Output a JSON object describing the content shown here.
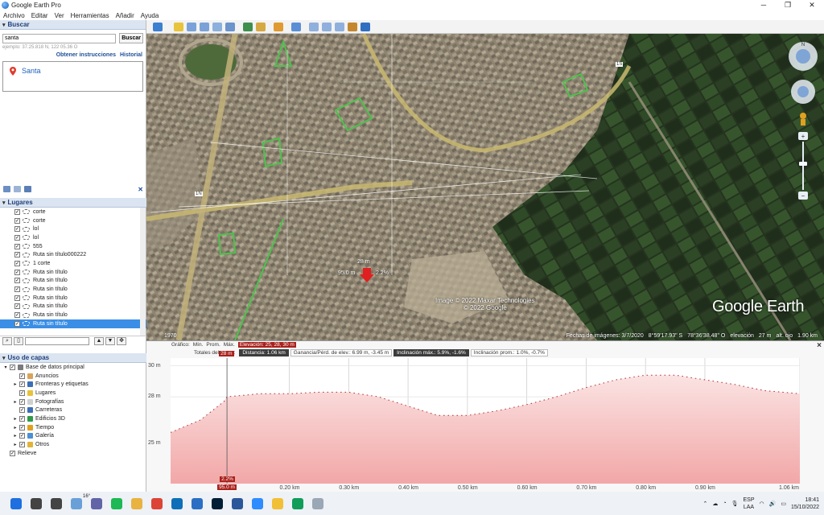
{
  "window": {
    "title": "Google Earth Pro",
    "min": "─",
    "max": "❐",
    "close": "✕"
  },
  "menu": [
    "Archivo",
    "Editar",
    "Ver",
    "Herramientas",
    "Añadir",
    "Ayuda"
  ],
  "search": {
    "header": "Buscar",
    "query": "santa",
    "button": "Buscar",
    "hint": "ejemplo: 37.25.818 N, 122 05.36 O",
    "directions_link": "Obtener instrucciones",
    "history_link": "Historial",
    "result": "Santa"
  },
  "places": {
    "header": "Lugares",
    "items": [
      {
        "label": "corte",
        "checked": true,
        "selected": false
      },
      {
        "label": "corte",
        "checked": true,
        "selected": false
      },
      {
        "label": "lol",
        "checked": true,
        "selected": false
      },
      {
        "label": "lol",
        "checked": true,
        "selected": false
      },
      {
        "label": "555",
        "checked": true,
        "selected": false
      },
      {
        "label": "Ruta sin título000222",
        "checked": true,
        "selected": false
      },
      {
        "label": "1 corte",
        "checked": true,
        "selected": false
      },
      {
        "label": "Ruta sin título",
        "checked": true,
        "selected": false
      },
      {
        "label": "Ruta sin título",
        "checked": true,
        "selected": false
      },
      {
        "label": "Ruta sin título",
        "checked": true,
        "selected": false
      },
      {
        "label": "Ruta sin título",
        "checked": true,
        "selected": false
      },
      {
        "label": "Ruta sin título",
        "checked": true,
        "selected": false
      },
      {
        "label": "Ruta sin título",
        "checked": true,
        "selected": false
      },
      {
        "label": "Ruta sin título",
        "checked": true,
        "selected": true
      }
    ]
  },
  "layers": {
    "header": "Uso de capas",
    "items": [
      {
        "label": "Base de datos principal",
        "indent": 0,
        "expander": "▾",
        "color": "#7a7a7a"
      },
      {
        "label": "Anuncios",
        "indent": 1,
        "expander": "",
        "color": "#d8a35a"
      },
      {
        "label": "Fronteras y etiquetas",
        "indent": 1,
        "expander": "▸",
        "color": "#3b6fb6"
      },
      {
        "label": "Lugares",
        "indent": 1,
        "expander": "",
        "color": "#e7c23a"
      },
      {
        "label": "Fotografías",
        "indent": 1,
        "expander": "▸",
        "color": "#cfcfcf"
      },
      {
        "label": "Carreteras",
        "indent": 1,
        "expander": "",
        "color": "#3b6fb6"
      },
      {
        "label": "Edificios 3D",
        "indent": 1,
        "expander": "▸",
        "color": "#2f9a4a"
      },
      {
        "label": "Tiempo",
        "indent": 1,
        "expander": "▸",
        "color": "#e0a020"
      },
      {
        "label": "Galería",
        "indent": 1,
        "expander": "▸",
        "color": "#4b8fd4"
      },
      {
        "label": "Otros",
        "indent": 1,
        "expander": "▸",
        "color": "#e0b43a"
      },
      {
        "label": "Relieve",
        "indent": 0,
        "expander": "",
        "color": ""
      }
    ]
  },
  "map": {
    "credit_line1": "Image © 2022 Maxar Technologies",
    "credit_line2": "© 2022 Google",
    "logo": "Google Earth",
    "year": "1970",
    "imagery_date": "Fechas de imágenes: 3/7/2020",
    "lat": "8°59'17.93\" S",
    "lon": "78°36'38.48\" O",
    "elev_label": "elevación",
    "elev_value": "27 m",
    "eye_label": "alt. ojo",
    "eye_value": "1.90 km",
    "marker_label": "28 m",
    "marker_pct": "2.2%",
    "marker_dist": "95.0 m",
    "road_shield_1": "1N",
    "road_shield_2": "1S"
  },
  "profile": {
    "top_items": [
      "Gráfico:",
      "Mín.",
      "Prom.",
      "Máx."
    ],
    "elevation_stat": "Elevación: 25, 28, 30 m",
    "range_label": "Totales del rango:",
    "distance": "Distancia: 1.06 km",
    "gain": "Ganancia/Pérd. de elev.: 6.99 m, -3.45 m",
    "max_slope": "Inclinación máx.: 5.9%, -1.6%",
    "avg_slope": "Inclinación prom.: 1.0%, -0.7%",
    "close": "×",
    "cursor_label": "28 m",
    "cursor_slope": "2.2%",
    "cursor_dist": "95.0 m"
  },
  "chart_data": {
    "type": "area",
    "title": "",
    "xlabel": "",
    "ylabel": "",
    "ylim": [
      22.4,
      30.5
    ],
    "xlim": [
      0,
      1.06
    ],
    "y_ticks": [
      {
        "v": 30,
        "label": "30 m"
      },
      {
        "v": 28,
        "label": "28 m"
      },
      {
        "v": 25,
        "label": "25 m"
      }
    ],
    "x_ticks": [
      {
        "v": 0.2,
        "label": "0.20 km"
      },
      {
        "v": 0.3,
        "label": "0.30 km"
      },
      {
        "v": 0.4,
        "label": "0.40 km"
      },
      {
        "v": 0.5,
        "label": "0.50 km"
      },
      {
        "v": 0.6,
        "label": "0.60 km"
      },
      {
        "v": 0.7,
        "label": "0.70 km"
      },
      {
        "v": 0.8,
        "label": "0.80 km"
      },
      {
        "v": 0.9,
        "label": "0.90 km"
      },
      {
        "v": 1.06,
        "label": "1.06 km"
      }
    ],
    "x": [
      0,
      0.05,
      0.09,
      0.095,
      0.15,
      0.2,
      0.25,
      0.3,
      0.35,
      0.4,
      0.45,
      0.5,
      0.55,
      0.6,
      0.65,
      0.7,
      0.75,
      0.8,
      0.85,
      0.9,
      0.95,
      1.0,
      1.06
    ],
    "y": [
      25.7,
      26.5,
      27.7,
      28.0,
      28.2,
      28.2,
      28.3,
      28.3,
      28.0,
      27.4,
      26.8,
      26.8,
      27.1,
      27.5,
      28.0,
      28.6,
      29.1,
      29.4,
      29.4,
      29.1,
      28.8,
      28.4,
      28.2
    ],
    "cursor_x": 0.095
  },
  "taskbar": {
    "weather": "16°",
    "lang1": "ESP",
    "lang2": "LAA",
    "time": "18:41",
    "date": "15/10/2022",
    "apps": [
      {
        "name": "start",
        "color": "#1e6fe0"
      },
      {
        "name": "search",
        "color": "#444444"
      },
      {
        "name": "taskview",
        "color": "#444444"
      },
      {
        "name": "weather",
        "color": "#6aa0d8"
      },
      {
        "name": "teams",
        "color": "#6264a7"
      },
      {
        "name": "spotify",
        "color": "#1db954"
      },
      {
        "name": "explorer",
        "color": "#e8b340"
      },
      {
        "name": "chrome",
        "color": "#db4437"
      },
      {
        "name": "photos",
        "color": "#0d6fb8"
      },
      {
        "name": "app-blue",
        "color": "#2a6fc4"
      },
      {
        "name": "photoshop",
        "color": "#001e36"
      },
      {
        "name": "word",
        "color": "#2b579a"
      },
      {
        "name": "zoom",
        "color": "#2d8cff"
      },
      {
        "name": "files",
        "color": "#f2c037"
      },
      {
        "name": "chrome-2",
        "color": "#0f9d58"
      },
      {
        "name": "google-earth",
        "color": "#9aa7b5"
      }
    ]
  }
}
